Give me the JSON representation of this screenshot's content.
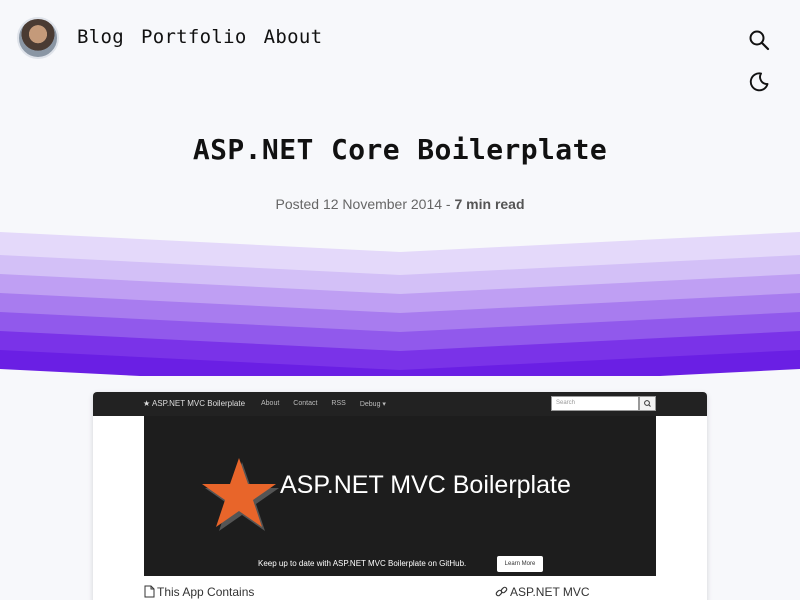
{
  "header": {
    "nav": [
      {
        "label": "Blog"
      },
      {
        "label": "Portfolio"
      },
      {
        "label": "About"
      }
    ],
    "icons": [
      "search-icon",
      "moon-icon"
    ]
  },
  "post": {
    "title": "ASP.NET Core Boilerplate",
    "posted_prefix": "Posted 12 November 2014 - ",
    "read_time": "7 min read"
  },
  "colors": {
    "wave_bands": [
      "#e4d9fa",
      "#d3c0f7",
      "#bf9ff3",
      "#a87cef",
      "#9159ec",
      "#7a33e8",
      "#6a1fe4"
    ],
    "accent": "#6a1fe4"
  },
  "screenshot": {
    "nav": {
      "brand": "ASP.NET MVC Boilerplate",
      "links": [
        "About",
        "Contact",
        "RSS",
        "Debug"
      ],
      "search_placeholder": "Search"
    },
    "hero": {
      "title": "ASP.NET MVC Boilerplate",
      "caption": "Keep up to date with ASP.NET MVC Boilerplate on GitHub.",
      "button": "Learn More",
      "slides": 5,
      "active_slide": 1
    },
    "sections": {
      "left": "This App Contains",
      "right": "ASP.NET MVC"
    }
  }
}
